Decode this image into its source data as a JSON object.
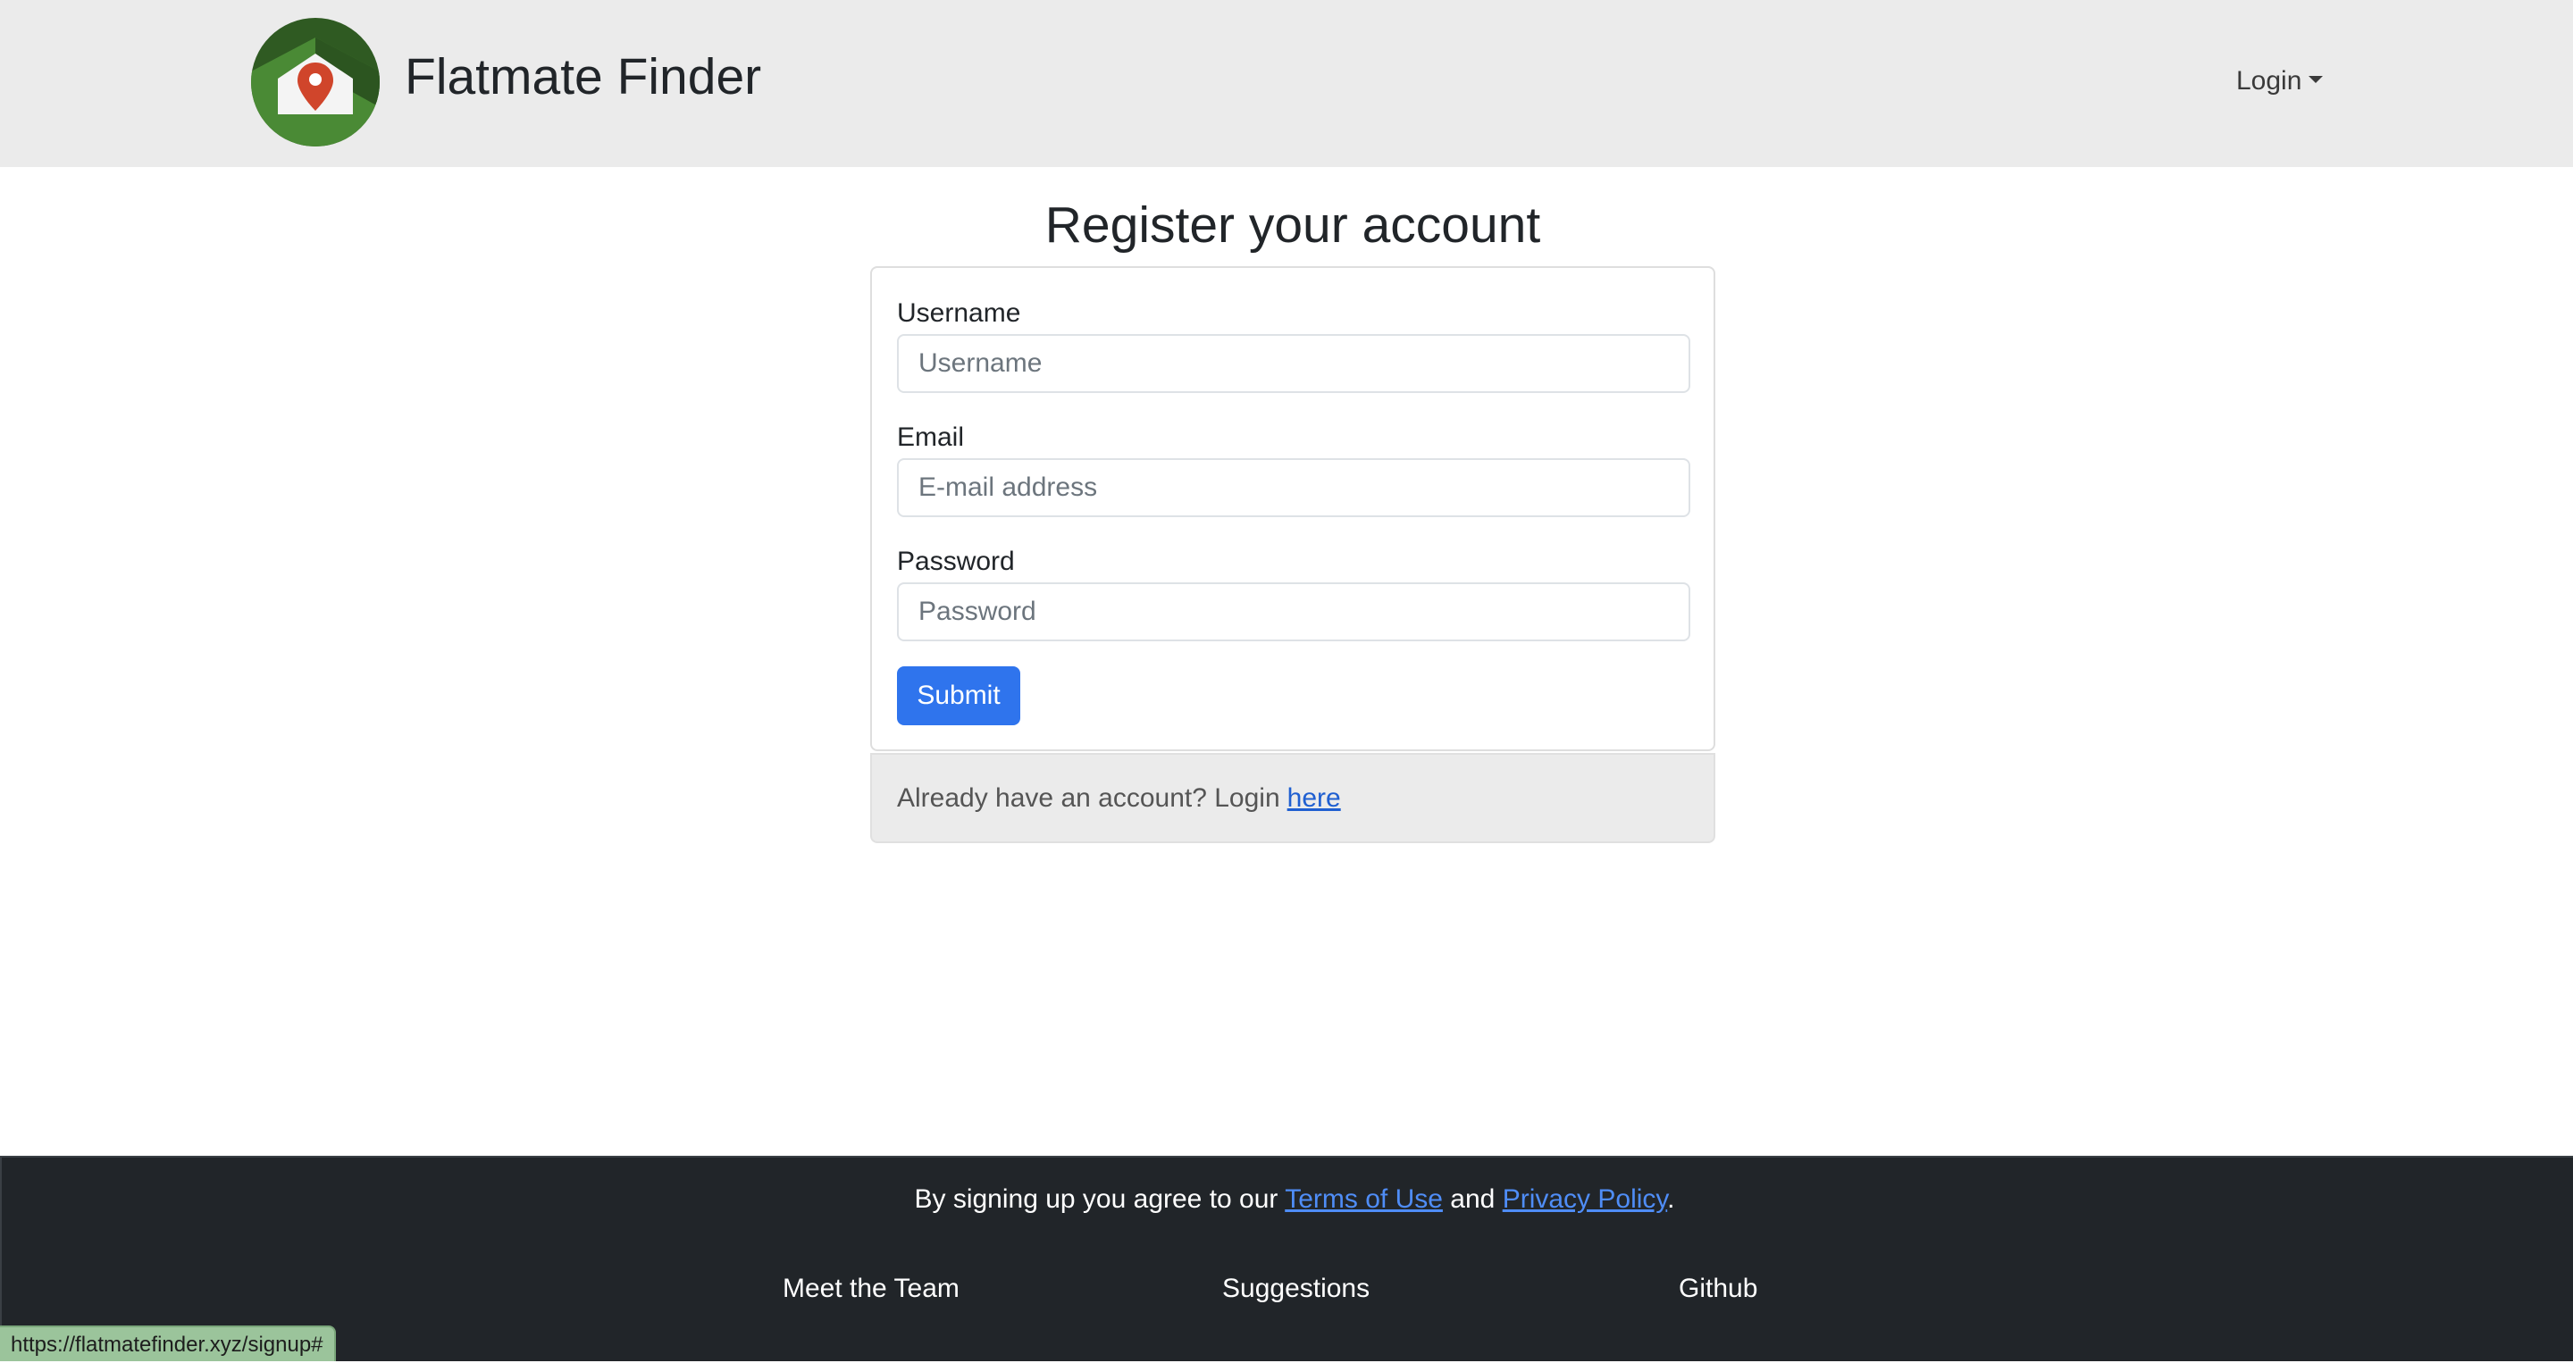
{
  "header": {
    "brand": "Flatmate Finder",
    "login_label": "Login"
  },
  "form": {
    "title": "Register your account",
    "username_label": "Username",
    "username_placeholder": "Username",
    "email_label": "Email",
    "email_placeholder": "E-mail address",
    "password_label": "Password",
    "password_placeholder": "Password",
    "submit_label": "Submit"
  },
  "card_footer": {
    "text": "Already have an account? Login",
    "link_label": "here"
  },
  "footer": {
    "agree_prefix": "By signing up you agree to our",
    "terms_label": "Terms of Use",
    "and_text": "and",
    "privacy_label": "Privacy Policy",
    "period": ".",
    "links": [
      "Meet the Team",
      "Suggestions",
      "Github"
    ]
  },
  "status_bar": {
    "url": "https://flatmatefinder.xyz/signup#"
  },
  "colors": {
    "navbar_bg": "#ebebeb",
    "primary": "#2f74ed",
    "footer_bg": "#212529",
    "logo_green": "#4a8a35",
    "logo_pin": "#d0452b"
  },
  "icons": {
    "logo": "house-location-pin-icon",
    "dropdown": "caret-down-icon"
  }
}
